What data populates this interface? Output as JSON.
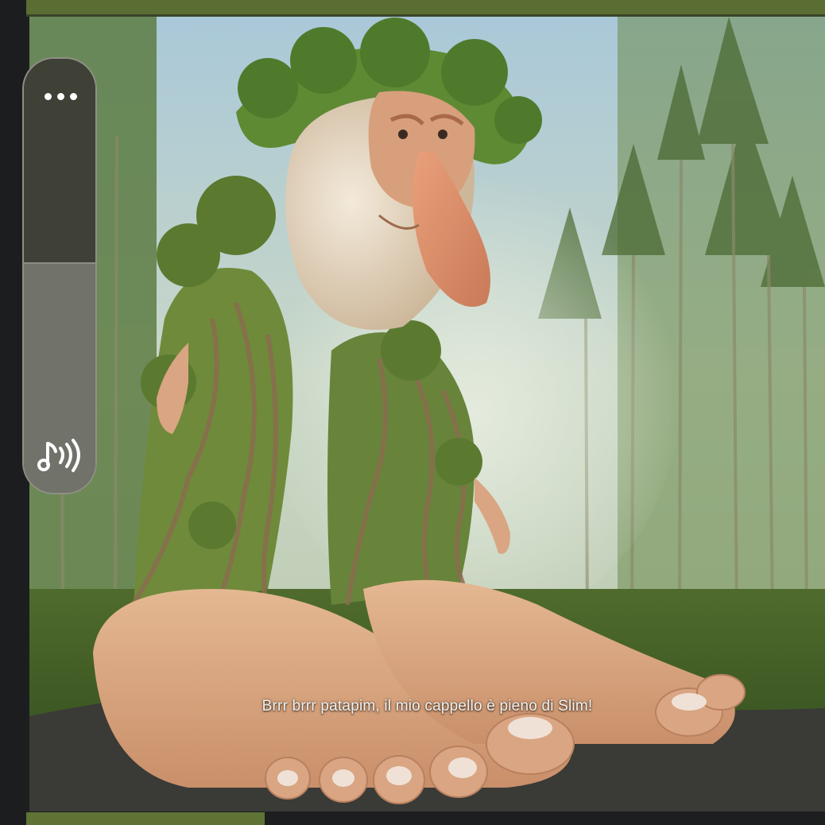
{
  "video": {
    "subtitle": "Brrr brrr patapim, il mio cappello è pieno di Slim!"
  },
  "volume_control": {
    "level_percent": 53,
    "more_icon": "more-horizontal-icon",
    "sound_icon": "music-note-volume-icon"
  },
  "colors": {
    "top_bar": "#5a6e34",
    "bottom_bar": "#5f7434",
    "panel_dark": "#3f4036",
    "panel_fill": "#717269"
  }
}
